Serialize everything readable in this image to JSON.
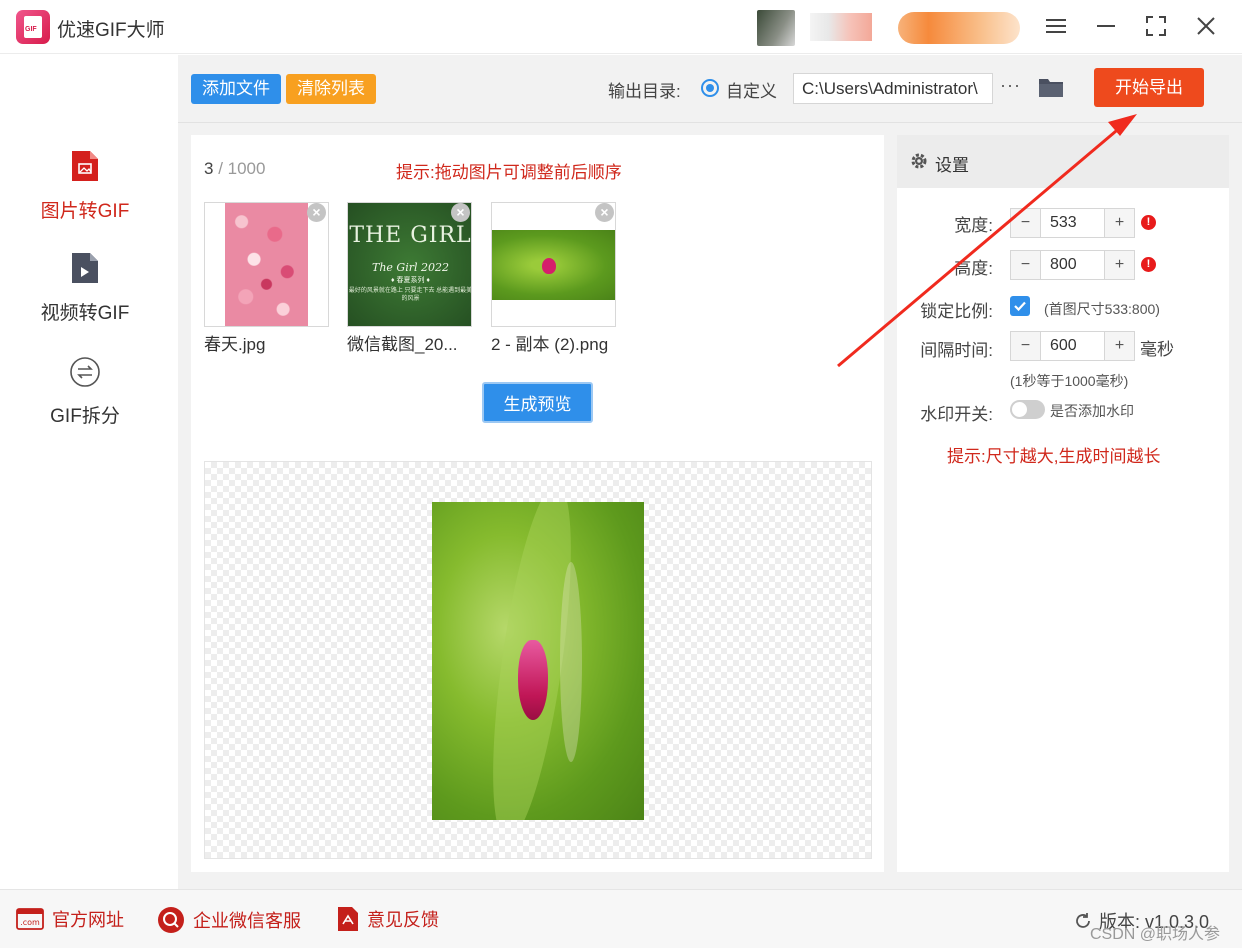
{
  "app": {
    "title": "优速GIF大师",
    "logo_text": "GIF",
    "accent_color": "#ee4a1d",
    "primary_color": "#2f8fea"
  },
  "window_controls": {
    "menu_icon": "menu-icon",
    "minimize_icon": "minimize-icon",
    "maximize_icon": "maximize-icon",
    "close_icon": "close-icon"
  },
  "sidebar": {
    "items": [
      {
        "label": "图片转GIF",
        "icon": "image-file-icon",
        "active": true
      },
      {
        "label": "视频转GIF",
        "icon": "video-file-icon",
        "active": false
      },
      {
        "label": "GIF拆分",
        "icon": "split-icon",
        "active": false
      }
    ]
  },
  "toolbar": {
    "add_label": "添加文件",
    "clear_label": "清除列表",
    "output_label": "输出目录:",
    "custom_label": "自定义",
    "path_value": "C:\\Users\\Administrator\\",
    "more_label": "···",
    "export_label": "开始导出"
  },
  "list": {
    "count": "3",
    "max": "/ 1000",
    "hint": "提示:拖动图片可调整前后顺序",
    "files": [
      {
        "name": "春天.jpg"
      },
      {
        "name": "微信截图_20...",
        "overlay_title": "THE GIRL",
        "overlay_sub": "The Girl 2022",
        "overlay_tag": "♦ 春夏系列 ♦",
        "overlay_text": "最好的风景就在路上 只要走下去 总能遇到最美的风景"
      },
      {
        "name": "2 - 副本 (2).png"
      }
    ],
    "preview_button": "生成预览"
  },
  "settings": {
    "title": "设置",
    "width_label": "宽度:",
    "width_value": "533",
    "height_label": "高度:",
    "height_value": "800",
    "lock_label": "锁定比例:",
    "lock_checked": true,
    "lock_note": "(首图尺寸533:800)",
    "interval_label": "间隔时间:",
    "interval_value": "600",
    "interval_unit": "毫秒",
    "interval_note": "(1秒等于1000毫秒)",
    "watermark_label": "水印开关:",
    "watermark_note": "是否添加水印",
    "watermark_on": false,
    "tip": "提示:尺寸越大,生成时间越长",
    "minus": "−",
    "plus": "+",
    "warn_mark": "!"
  },
  "footer": {
    "site_label": "官方网址",
    "service_label": "企业微信客服",
    "feedback_label": "意见反馈",
    "version_label": "版本: v1.0.3.0",
    "watermark_text": "CSDN @职场人参"
  }
}
